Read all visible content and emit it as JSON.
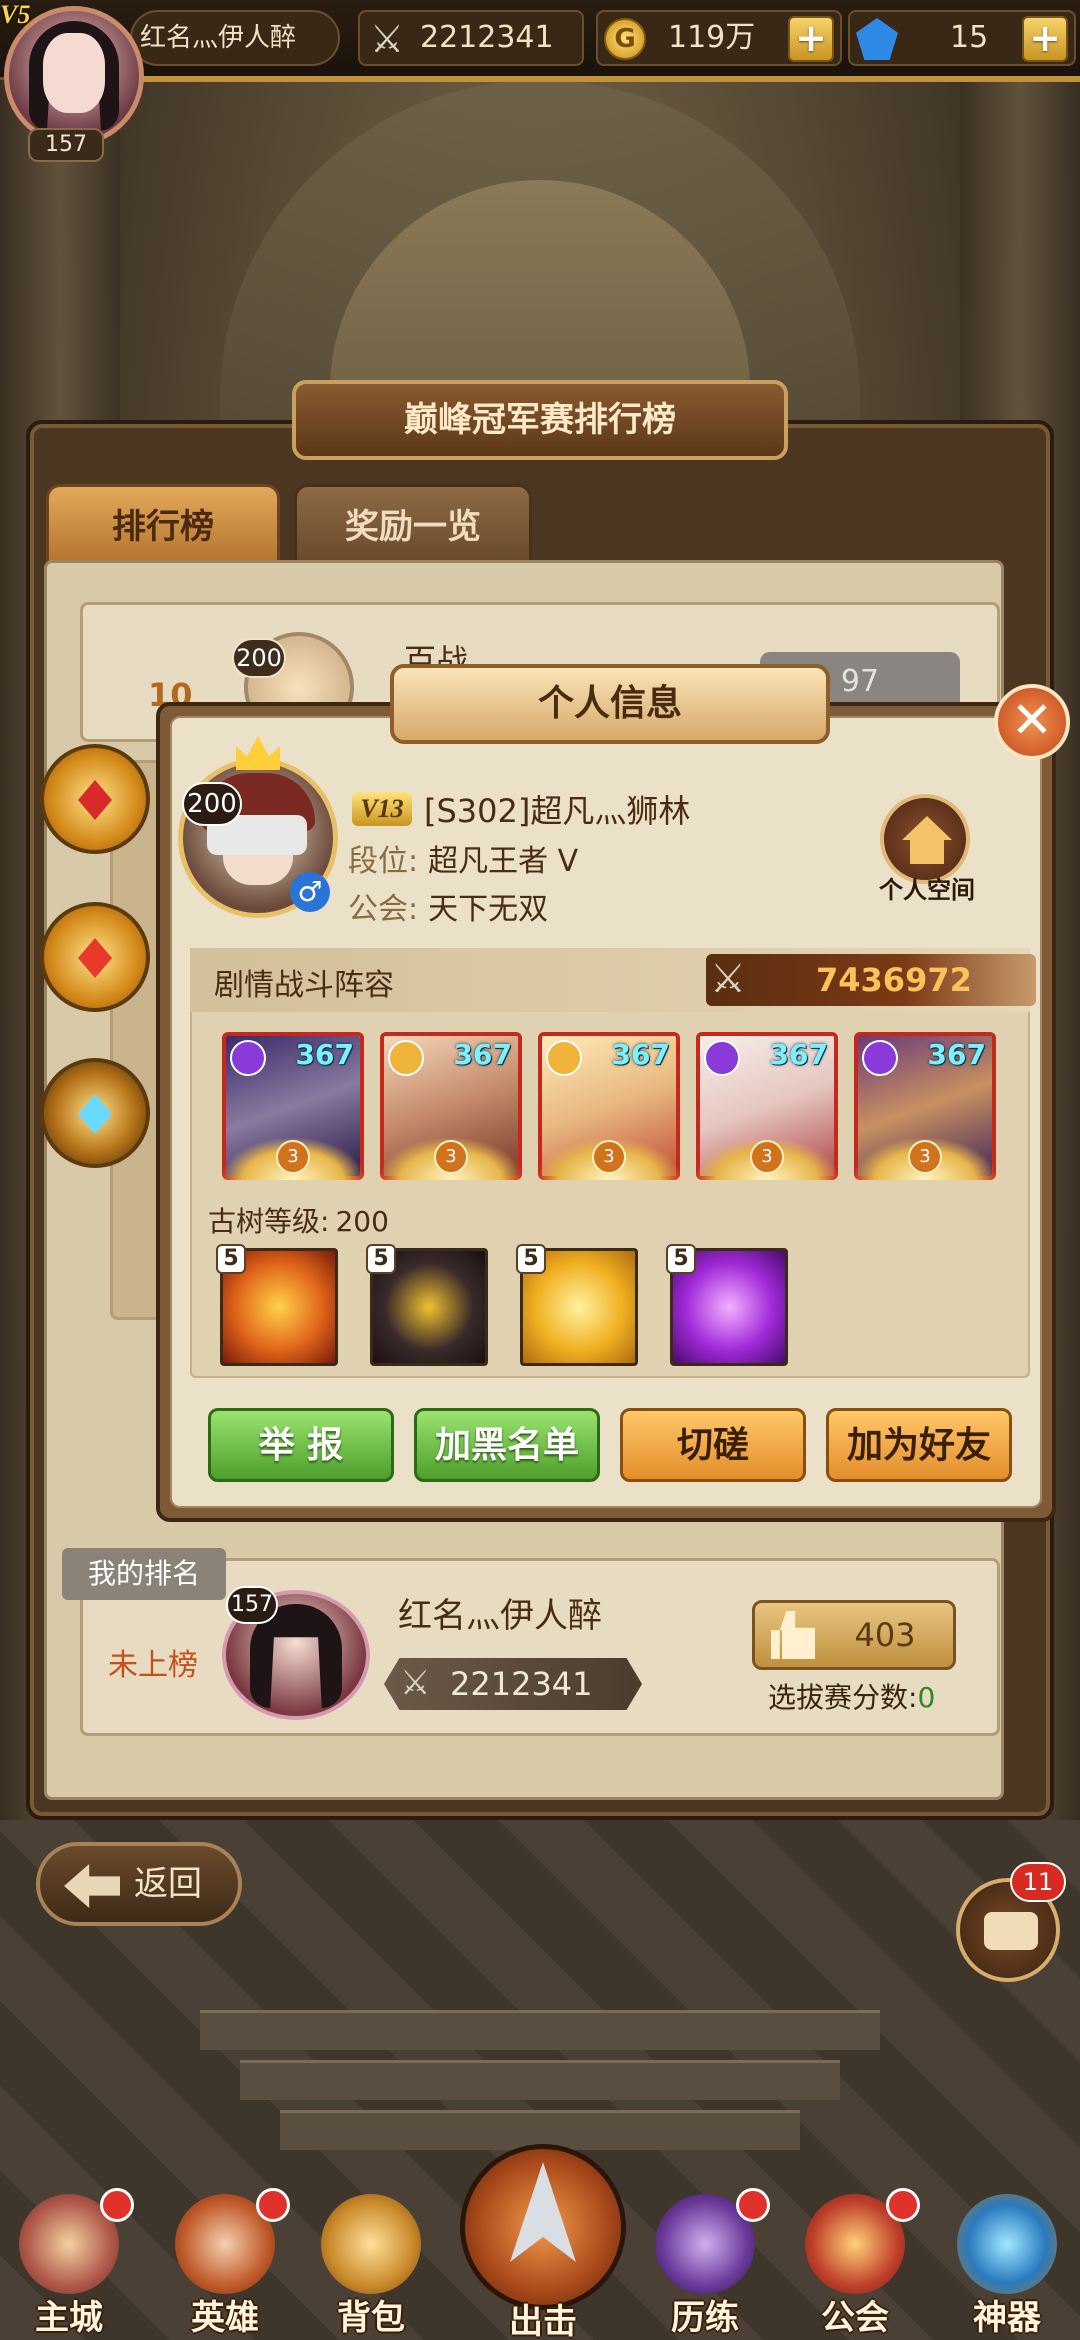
{
  "topbar": {
    "vip": "V5",
    "level": "157",
    "player_name": "红名灬伊人醉",
    "combat_power": "2212341",
    "gold": "119万",
    "gems": "15",
    "plus": "+"
  },
  "panel": {
    "title": "巅峰冠军赛排行榜",
    "tabs": [
      "排行榜",
      "奖励一览"
    ],
    "bg_row": {
      "level": "200",
      "name": "百战",
      "value": "97",
      "rank": "10"
    }
  },
  "popup": {
    "title": "个人信息",
    "close": "✕",
    "player": {
      "level": "200",
      "vip": "V13",
      "name": "[S302]超凡灬狮林",
      "rank_label": "段位:",
      "rank_value": "超凡王者 V",
      "guild_label": "公会:",
      "guild_value": "天下无双",
      "gender": "♂"
    },
    "home_label": "个人空间",
    "lineup_title": "剧情战斗阵容",
    "lineup_power": "7436972",
    "heroes": [
      {
        "level": "367",
        "element": "moon",
        "stars": "3"
      },
      {
        "level": "367",
        "element": "sun",
        "stars": "3"
      },
      {
        "level": "367",
        "element": "sun",
        "stars": "3"
      },
      {
        "level": "367",
        "element": "moon",
        "stars": "3"
      },
      {
        "level": "367",
        "element": "moon",
        "stars": "3"
      }
    ],
    "tree_label": "古树等级:",
    "tree_level": "200",
    "skills": [
      {
        "level": "5",
        "icon": "fire-dragon-skill-icon"
      },
      {
        "level": "5",
        "icon": "dark-beast-skill-icon"
      },
      {
        "level": "5",
        "icon": "holy-cross-skill-icon"
      },
      {
        "level": "5",
        "icon": "purple-sprout-skill-icon"
      }
    ],
    "buttons": {
      "report": "举 报",
      "blacklist": "加黑名单",
      "duel": "切磋",
      "add_friend": "加为好友"
    }
  },
  "my_rank": {
    "tag": "我的排名",
    "status": "未上榜",
    "level": "157",
    "name": "红名灬伊人醉",
    "power": "2212341",
    "likes": "403",
    "score_label": "选拔赛分数:",
    "score_value": "0"
  },
  "back_label": "返回",
  "chat_badge": "11",
  "nav": [
    "主城",
    "英雄",
    "背包",
    "出击",
    "历练",
    "公会",
    "神器"
  ],
  "colors": {
    "accent_gold": "#c2923a",
    "green_button": "#4e9f2c",
    "orange_button": "#e38e2a",
    "hero_frame": "#c7281c",
    "hero_level": "#7cf0ff",
    "power_value": "#ffc25a"
  }
}
